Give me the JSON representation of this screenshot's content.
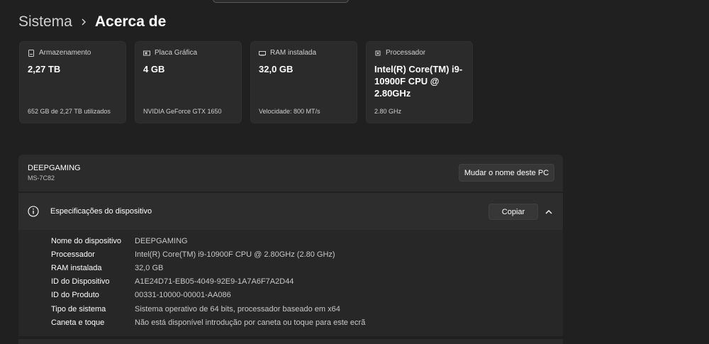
{
  "breadcrumb": {
    "parent": "Sistema",
    "current": "Acerca de"
  },
  "cards": [
    {
      "icon": "storage-icon",
      "title": "Armazenamento",
      "value": "2,27 TB",
      "sub": "652 GB de 2,27 TB utilizados"
    },
    {
      "icon": "gpu-icon",
      "title": "Placa Gráfica",
      "value": "4 GB",
      "sub": "NVIDIA GeForce GTX 1650"
    },
    {
      "icon": "ram-icon",
      "title": "RAM instalada",
      "value": "32,0 GB",
      "sub": "Velocidade: 800 MT/s"
    },
    {
      "icon": "processor-icon",
      "title": "Processador",
      "value": "Intel(R) Core(TM) i9-10900F CPU @ 2.80GHz",
      "sub": "2.80 GHz"
    }
  ],
  "pc": {
    "name": "DEEPGAMING",
    "model": "MS-7C82",
    "rename_label": "Mudar o nome deste PC"
  },
  "specs": {
    "title": "Especificações do dispositivo",
    "copy_label": "Copiar",
    "rows": [
      {
        "label": "Nome do dispositivo",
        "value": "DEEPGAMING"
      },
      {
        "label": "Processador",
        "value": "Intel(R) Core(TM) i9-10900F CPU @ 2.80GHz (2.80 GHz)"
      },
      {
        "label": "RAM instalada",
        "value": "32,0 GB"
      },
      {
        "label": "ID do Dispositivo",
        "value": "A1E24D71-EB05-4049-92E9-1A7A6F7A2D44"
      },
      {
        "label": "ID do Produto",
        "value": "00331-10000-00001-AA086"
      },
      {
        "label": "Tipo de sistema",
        "value": "Sistema operativo de 64 bits, processador baseado em x64"
      },
      {
        "label": "Caneta e toque",
        "value": "Não está disponível introdução por caneta ou toque para este ecrã"
      }
    ]
  }
}
